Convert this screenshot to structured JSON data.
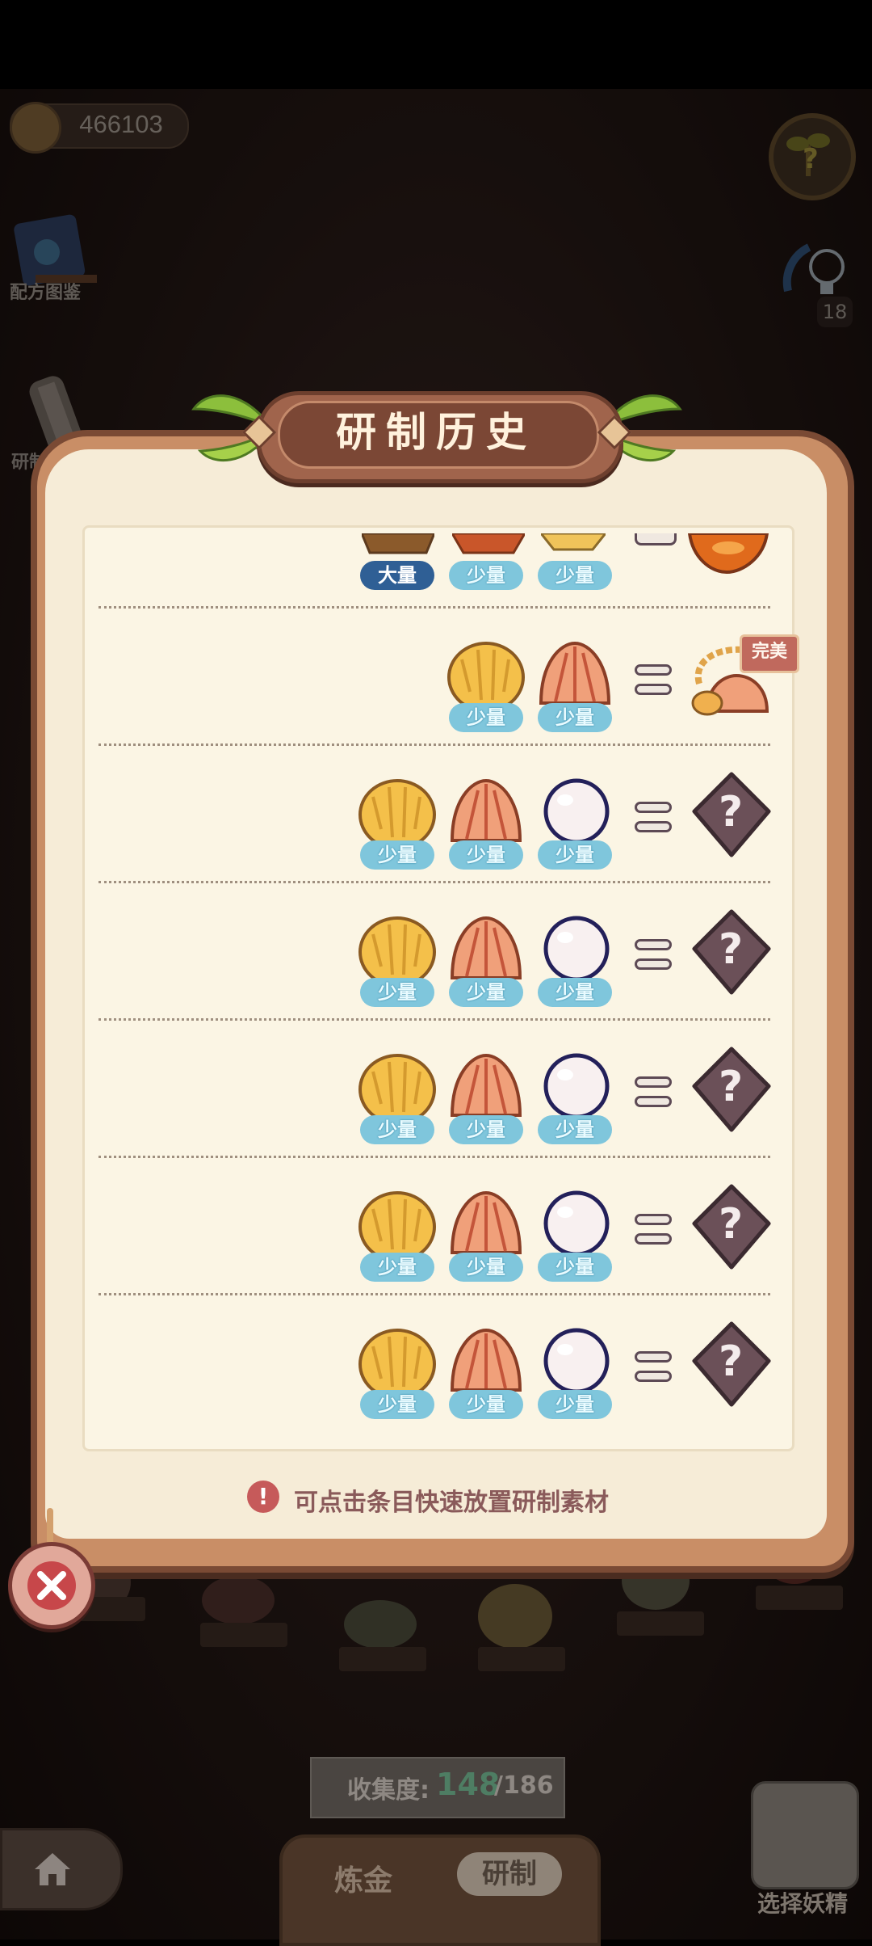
{
  "header": {
    "coins": "466103",
    "hint_count": "18"
  },
  "sidebar": {
    "recipe_book_label": "配方图鉴",
    "history_label": "研制历史"
  },
  "dialog": {
    "title": "研制历史",
    "hint_text": "可点击条目快速放置研制素材",
    "perfect_label": "完美",
    "rows": [
      {
        "tags": [
          "大量",
          "少量",
          "少量"
        ]
      },
      {
        "tags": [
          "少量",
          "少量"
        ]
      },
      {
        "tags": [
          "少量",
          "少量",
          "少量"
        ]
      },
      {
        "tags": [
          "少量",
          "少量",
          "少量"
        ]
      },
      {
        "tags": [
          "少量",
          "少量",
          "少量"
        ]
      },
      {
        "tags": [
          "少量",
          "少量",
          "少量"
        ]
      },
      {
        "tags": [
          "少量",
          "少量",
          "少量"
        ]
      }
    ]
  },
  "footer": {
    "collection_label": "收集度:",
    "collection_value": "148",
    "collection_total": "/186",
    "tab_alchemy": "炼金",
    "tab_research": "研制",
    "select_fairy_label": "选择妖精"
  },
  "colors": {
    "dialog_frame": "#c98e66",
    "dialog_paper": "#f6ecd7",
    "tag_small": "#7fc6dc",
    "tag_big": "#2f5f95",
    "title_plate": "#7b4735"
  },
  "icons": [
    "coin-icon",
    "help-sprout-icon",
    "lightbulb-icon",
    "recipe-book-icon",
    "scroll-icon",
    "coconut-icon",
    "clam-shell-icon",
    "pearl-icon",
    "unknown-result-icon",
    "shell-necklace-icon",
    "alert-icon",
    "close-icon",
    "home-icon"
  ]
}
